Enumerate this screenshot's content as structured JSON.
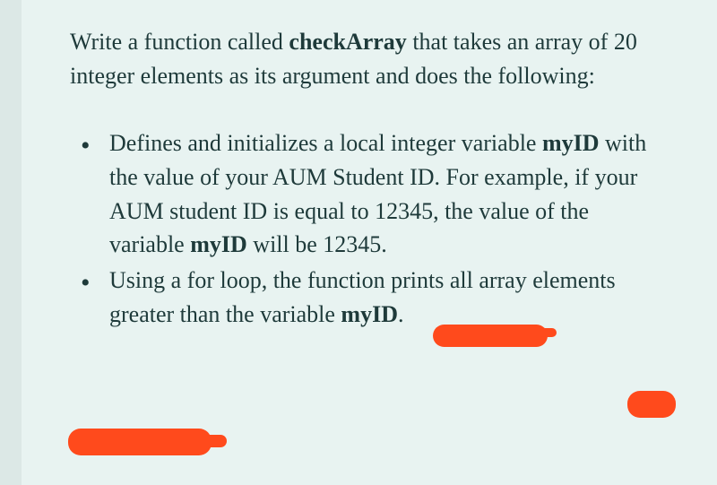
{
  "intro": {
    "part1": "Write a function called ",
    "bold1": "checkArray",
    "part2": " that takes an array of 20 integer elements as its argument and does the following:"
  },
  "bullets": [
    {
      "part1": "Defines and initializes a local integer variable ",
      "bold1": "myID",
      "part2": " with the value of your AUM Student ID. For example, if your AUM student ID is equal to 12345, the value of the variable ",
      "bold2": "myID",
      "part3": " will be 12345."
    },
    {
      "part1": "Using a for loop, the function prints all array elements greater than the variable ",
      "bold1": "myID",
      "part2": "."
    }
  ]
}
